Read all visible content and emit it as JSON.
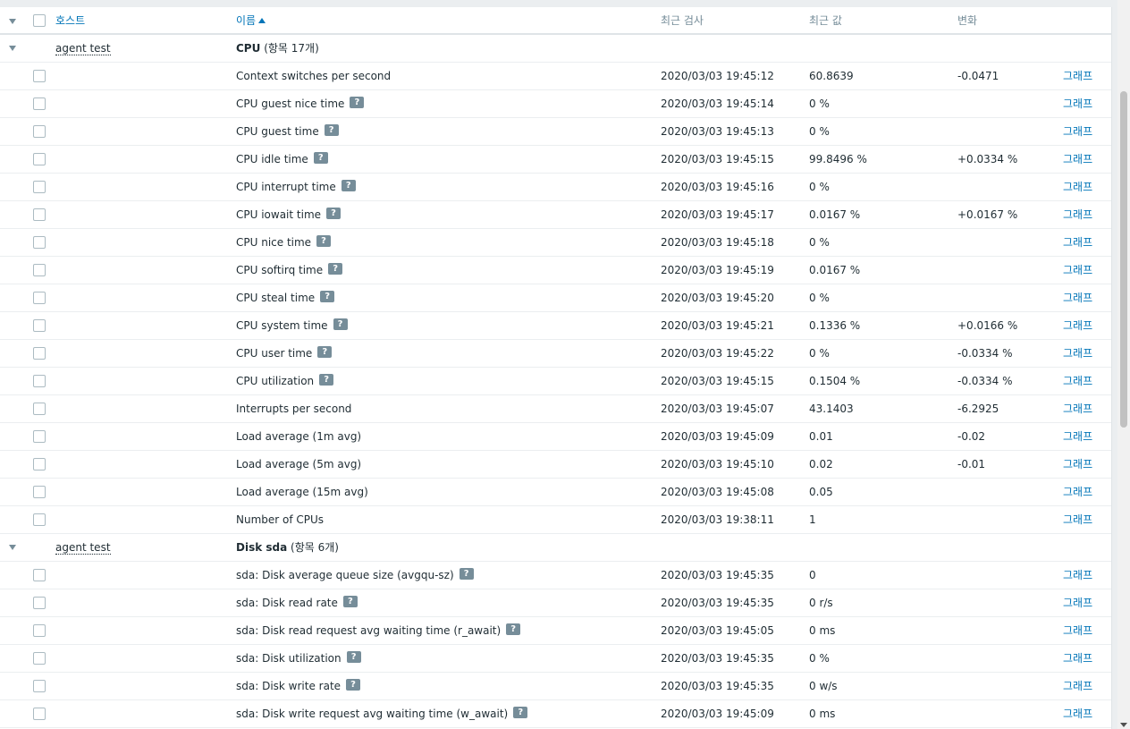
{
  "header": {
    "host": "호스트",
    "name": "이름",
    "last_check": "최근 검사",
    "last_value": "최근 값",
    "change": "변화"
  },
  "groups": [
    {
      "host": "agent test",
      "app": "CPU",
      "count": "(항목 17개)",
      "items": [
        {
          "name": "Context switches per second",
          "help": false,
          "time": "2020/03/03 19:45:12",
          "value": "60.8639",
          "change": "-0.0471",
          "graph": "그래프"
        },
        {
          "name": "CPU guest nice time",
          "help": true,
          "time": "2020/03/03 19:45:14",
          "value": "0 %",
          "change": "",
          "graph": "그래프"
        },
        {
          "name": "CPU guest time",
          "help": true,
          "time": "2020/03/03 19:45:13",
          "value": "0 %",
          "change": "",
          "graph": "그래프"
        },
        {
          "name": "CPU idle time",
          "help": true,
          "time": "2020/03/03 19:45:15",
          "value": "99.8496 %",
          "change": "+0.0334 %",
          "graph": "그래프"
        },
        {
          "name": "CPU interrupt time",
          "help": true,
          "time": "2020/03/03 19:45:16",
          "value": "0 %",
          "change": "",
          "graph": "그래프"
        },
        {
          "name": "CPU iowait time",
          "help": true,
          "time": "2020/03/03 19:45:17",
          "value": "0.0167 %",
          "change": "+0.0167 %",
          "graph": "그래프"
        },
        {
          "name": "CPU nice time",
          "help": true,
          "time": "2020/03/03 19:45:18",
          "value": "0 %",
          "change": "",
          "graph": "그래프"
        },
        {
          "name": "CPU softirq time",
          "help": true,
          "time": "2020/03/03 19:45:19",
          "value": "0.0167 %",
          "change": "",
          "graph": "그래프"
        },
        {
          "name": "CPU steal time",
          "help": true,
          "time": "2020/03/03 19:45:20",
          "value": "0 %",
          "change": "",
          "graph": "그래프"
        },
        {
          "name": "CPU system time",
          "help": true,
          "time": "2020/03/03 19:45:21",
          "value": "0.1336 %",
          "change": "+0.0166 %",
          "graph": "그래프"
        },
        {
          "name": "CPU user time",
          "help": true,
          "time": "2020/03/03 19:45:22",
          "value": "0 %",
          "change": "-0.0334 %",
          "graph": "그래프"
        },
        {
          "name": "CPU utilization",
          "help": true,
          "time": "2020/03/03 19:45:15",
          "value": "0.1504 %",
          "change": "-0.0334 %",
          "graph": "그래프"
        },
        {
          "name": "Interrupts per second",
          "help": false,
          "time": "2020/03/03 19:45:07",
          "value": "43.1403",
          "change": "-6.2925",
          "graph": "그래프"
        },
        {
          "name": "Load average (1m avg)",
          "help": false,
          "time": "2020/03/03 19:45:09",
          "value": "0.01",
          "change": "-0.02",
          "graph": "그래프"
        },
        {
          "name": "Load average (5m avg)",
          "help": false,
          "time": "2020/03/03 19:45:10",
          "value": "0.02",
          "change": "-0.01",
          "graph": "그래프"
        },
        {
          "name": "Load average (15m avg)",
          "help": false,
          "time": "2020/03/03 19:45:08",
          "value": "0.05",
          "change": "",
          "graph": "그래프"
        },
        {
          "name": "Number of CPUs",
          "help": false,
          "time": "2020/03/03 19:38:11",
          "value": "1",
          "change": "",
          "graph": "그래프"
        }
      ]
    },
    {
      "host": "agent test",
      "app": "Disk sda",
      "count": "(항목 6개)",
      "items": [
        {
          "name": "sda: Disk average queue size (avgqu-sz)",
          "help": true,
          "time": "2020/03/03 19:45:35",
          "value": "0",
          "change": "",
          "graph": "그래프"
        },
        {
          "name": "sda: Disk read rate",
          "help": true,
          "time": "2020/03/03 19:45:35",
          "value": "0 r/s",
          "change": "",
          "graph": "그래프"
        },
        {
          "name": "sda: Disk read request avg waiting time (r_await)",
          "help": true,
          "time": "2020/03/03 19:45:05",
          "value": "0 ms",
          "change": "",
          "graph": "그래프"
        },
        {
          "name": "sda: Disk utilization",
          "help": true,
          "time": "2020/03/03 19:45:35",
          "value": "0 %",
          "change": "",
          "graph": "그래프"
        },
        {
          "name": "sda: Disk write rate",
          "help": true,
          "time": "2020/03/03 19:45:35",
          "value": "0 w/s",
          "change": "",
          "graph": "그래프"
        },
        {
          "name": "sda: Disk write request avg waiting time (w_await)",
          "help": true,
          "time": "2020/03/03 19:45:09",
          "value": "0 ms",
          "change": "",
          "graph": "그래프"
        }
      ]
    }
  ],
  "icons": {
    "help": "?",
    "help_icon": "help-icon",
    "expand_icon": "collapse-triangle-icon",
    "sort_icon": "sort-ascending-icon"
  },
  "colors": {
    "link": "#0275b8",
    "text": "#1f2c33",
    "muted": "#768d99",
    "border": "#dfe4e7"
  }
}
